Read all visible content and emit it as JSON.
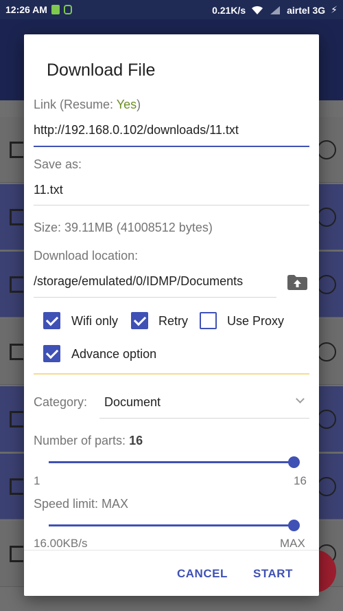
{
  "status_bar": {
    "time": "12:26 AM",
    "net_speed": "0.21K/s",
    "carrier": "airtel 3G"
  },
  "dialog": {
    "title": "Download File",
    "link_label_prefix": "Link (Resume: ",
    "link_label_resume": "Yes",
    "link_label_suffix": ")",
    "link_value": "http://192.168.0.102/downloads/11.txt",
    "save_as_label": "Save as:",
    "save_as_value": "11.txt",
    "size_text": "Size: 39.11MB (41008512 bytes)",
    "location_label": "Download location:",
    "location_value": "/storage/emulated/0/IDMP/Documents",
    "options": [
      {
        "label": "Wifi only",
        "checked": true
      },
      {
        "label": "Retry",
        "checked": true
      },
      {
        "label": "Use Proxy",
        "checked": false
      },
      {
        "label": "Advance option",
        "checked": true
      }
    ],
    "category_label": "Category:",
    "category_value": "Document",
    "parts_label": "Number of parts: ",
    "parts_value": "16",
    "parts_min": "1",
    "parts_max": "16",
    "parts_level": 1.0,
    "speed_label": "Speed limit: MAX",
    "speed_min": "16.00KB/s",
    "speed_max": "MAX",
    "speed_level": 1.0,
    "cancel_label": "CANCEL",
    "start_label": "START"
  },
  "colors": {
    "accent": "#3f51b5",
    "resume_yes": "#6b8e23",
    "divider_amber": "#f6dc8e"
  }
}
